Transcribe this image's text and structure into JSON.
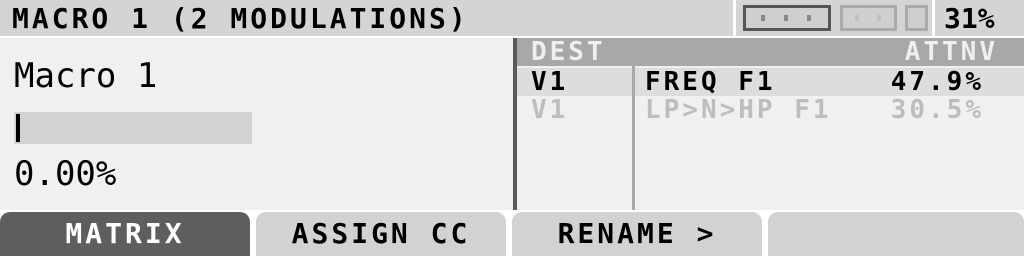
{
  "header": {
    "title": "MACRO 1 (2 MODULATIONS)",
    "cpu_percent": "31%",
    "meter_blocks": [
      "active",
      "active",
      "dim",
      "dim"
    ]
  },
  "macro": {
    "name": "Macro 1",
    "value": "0.00%",
    "slider_fraction": 0.0
  },
  "modulation_table": {
    "headers": {
      "dest": "DEST",
      "attnv": "ATTNV"
    },
    "rows": [
      {
        "source": "V1",
        "target": "FREQ F1",
        "amount": "47.9%",
        "selected": true
      },
      {
        "source": "V1",
        "target": "LP>N>HP F1",
        "amount": "30.5%",
        "selected": false
      }
    ]
  },
  "tabs": [
    {
      "label": "MATRIX",
      "active": true
    },
    {
      "label": "ASSIGN CC",
      "active": false
    },
    {
      "label": "RENAME >",
      "active": false
    },
    {
      "label": "",
      "active": false
    }
  ],
  "colors": {
    "background": "#f0f0f0",
    "header": "#d4d4d4",
    "table_header": "#a8a8a8",
    "active_tab": "#5e5e5e"
  }
}
